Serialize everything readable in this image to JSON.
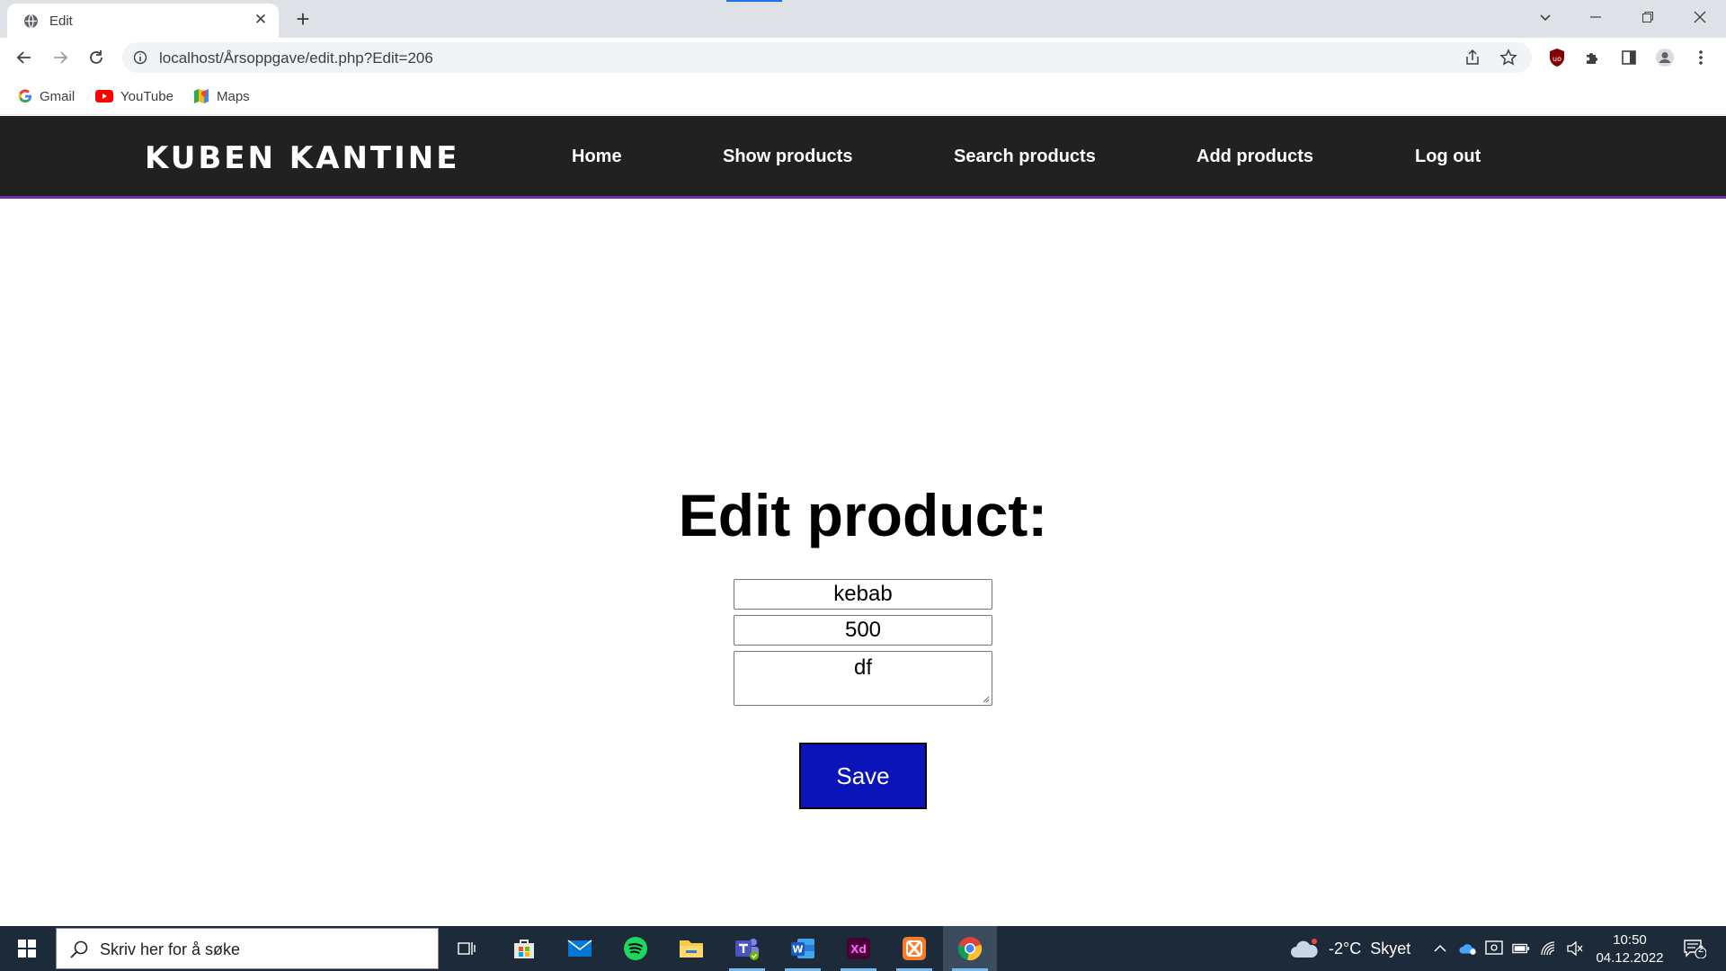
{
  "browser": {
    "tab_title": "Edit",
    "url": "localhost/Årsoppgave/edit.php?Edit=206",
    "bookmarks": [
      {
        "label": "Gmail",
        "icon": "google-icon"
      },
      {
        "label": "YouTube",
        "icon": "youtube-icon"
      },
      {
        "label": "Maps",
        "icon": "maps-icon"
      }
    ]
  },
  "site": {
    "brand": "KUBEN KANTINE",
    "nav": [
      "Home",
      "Show products",
      "Search products",
      "Add products",
      "Log out"
    ],
    "header_color": "#212121",
    "header_accent": "#6a2db4"
  },
  "form": {
    "title": "Edit product:",
    "name_value": "kebab",
    "price_value": "500",
    "description_value": "df",
    "save_label": "Save",
    "save_color": "#0a14b9"
  },
  "taskbar": {
    "search_placeholder": "Skriv her for å søke",
    "weather_temp": "-2°C",
    "weather_text": "Skyet",
    "time": "10:50",
    "date": "04.12.2022",
    "notification_count": "2"
  }
}
